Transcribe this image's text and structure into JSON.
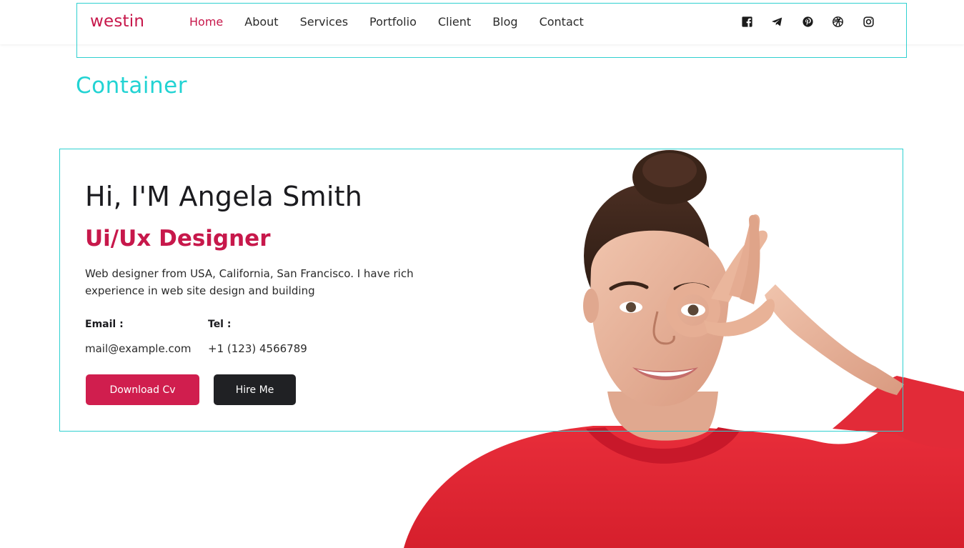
{
  "header": {
    "logo": "westin",
    "nav": [
      {
        "label": "Home",
        "active": true
      },
      {
        "label": "About"
      },
      {
        "label": "Services"
      },
      {
        "label": "Portfolio"
      },
      {
        "label": "Client"
      },
      {
        "label": "Blog"
      },
      {
        "label": "Contact"
      }
    ],
    "social_icons": [
      "facebook-icon",
      "telegram-icon",
      "pinterest-icon",
      "dribbble-icon",
      "instagram-icon"
    ]
  },
  "container_label": "Container",
  "hero": {
    "greeting": "Hi, I'M Angela Smith",
    "role": "Ui/Ux Designer",
    "description": "Web designer from USA, California, San Francisco. I have rich experience in web site design and building",
    "email_label": "Email :",
    "email_value": "mail@example.com",
    "tel_label": "Tel :",
    "tel_value": "+1 (123) 4566789",
    "download_button": "Download Cv",
    "hire_button": "Hire Me"
  },
  "colors": {
    "accent": "#c7184b",
    "button_primary": "#d01e4e",
    "button_dark": "#202124",
    "outline": "#2fd0d0",
    "sweater": "#e62735"
  }
}
